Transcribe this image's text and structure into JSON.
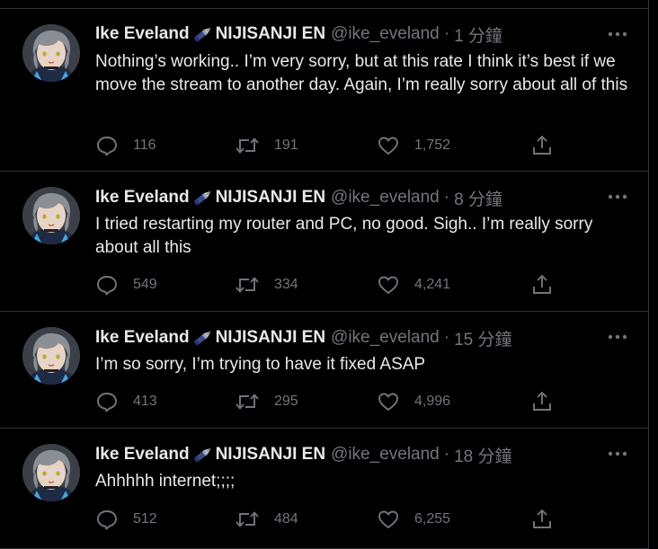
{
  "tweets": [
    {
      "name_prefix": "Ike Eveland",
      "name_suffix": "NIJISANJI EN",
      "handle": "@ike_eveland",
      "separator": "·",
      "time": "1 分鐘",
      "text": "Nothing’s working.. I’m very sorry, but at this rate I think it’s best if we move the stream to another day. Again, I’m really sorry about all of this",
      "replies": "116",
      "retweets": "191",
      "likes": "1,752"
    },
    {
      "name_prefix": "Ike Eveland",
      "name_suffix": "NIJISANJI EN",
      "handle": "@ike_eveland",
      "separator": "·",
      "time": "8 分鐘",
      "text": "I tried restarting my router and PC, no good. Sigh.. I’m really sorry about all this",
      "replies": "549",
      "retweets": "334",
      "likes": "4,241"
    },
    {
      "name_prefix": "Ike Eveland",
      "name_suffix": "NIJISANJI EN",
      "handle": "@ike_eveland",
      "separator": "·",
      "time": "15 分鐘",
      "text": "I’m so sorry, I’m trying to have it fixed ASAP",
      "replies": "413",
      "retweets": "295",
      "likes": "4,996"
    },
    {
      "name_prefix": "Ike Eveland",
      "name_suffix": "NIJISANJI EN",
      "handle": "@ike_eveland",
      "separator": "·",
      "time": "18 分鐘",
      "text": "Ahhhhh internet;;;;",
      "replies": "512",
      "retweets": "484",
      "likes": "6,255"
    }
  ],
  "icons": {
    "more": "more-horizontal-icon",
    "reply": "reply-bubble-icon",
    "retweet": "retweet-icon",
    "like": "heart-icon",
    "share": "share-upload-icon",
    "emoji": "fountain-pen-emoji"
  },
  "colors": {
    "background": "#000000",
    "text": "#e7e9ea",
    "muted": "#71767b",
    "divider": "#2f3336"
  }
}
